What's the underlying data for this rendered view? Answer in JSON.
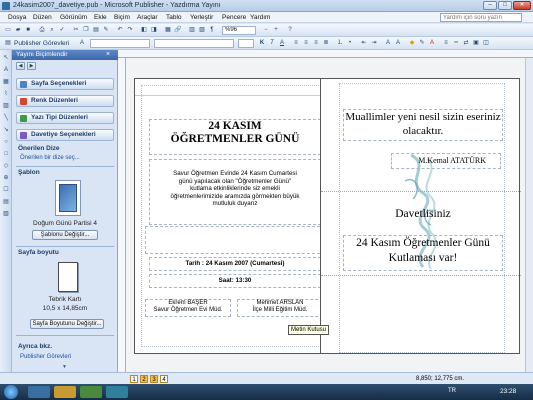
{
  "window": {
    "title": "24kasim2007_davetiye.pub - Microsoft Publisher - Yazdırma Yayını"
  },
  "menu": {
    "items": [
      "Dosya",
      "Düzen",
      "Görünüm",
      "Ekle",
      "Biçim",
      "Araçlar",
      "Tablo",
      "Yerleştir",
      "Pencere",
      "Yardım"
    ],
    "help_placeholder": "Yardım için soru yazın"
  },
  "toolbar": {
    "zoom": "%96",
    "tasks_label": "Publisher Görevleri"
  },
  "taskpane": {
    "title": "Yayını Biçimlendir",
    "sections": [
      "Sayfa Seçenekleri",
      "Renk Düzenleri",
      "Yazı Tipi Düzenleri",
      "Davetiye Seçenekleri"
    ],
    "design_label": "Önerilen Dize",
    "design_link": "Önerilen bir dize seç...",
    "template_label": "Şablon",
    "template_name": "Doğum Günü Partisi 4",
    "template_button": "Şablonu Değiştir...",
    "page_size_label": "Sayfa boyutu",
    "page_size_name": "Tebrik Kartı",
    "page_size_dims": "10,5 x 14,85cm",
    "page_size_button": "Sayfa Boyutunu Değiştir...",
    "see_also": "Ayrıca bkz.",
    "see_also_link": "Publisher Görevleri"
  },
  "left_page": {
    "title_line1": "24 KASIM",
    "title_line2": "ÖĞRETMENLER GÜNÜ",
    "body": "Savur Öğretmen Evinde 24 Kasım Cumartesi günü yapılacak olan \"Öğretmenler Günü\" kutlama etkinliklerinde siz emekli öğretmenlerimizide aramızda görmekten büyük mutluluk duyarız",
    "date": "Tarih : 24 Kasım 2007 (Cumartesi)",
    "time": "Saat: 13:30",
    "sig1_name": "Ekrem BAŞER",
    "sig1_title": "Savur Öğretmen Evi Müd.",
    "sig2_name": "Mehmet ARSLAN",
    "sig2_title": "İlçe Milli Eğitim Müd."
  },
  "right_page": {
    "quote": "Muallimler yeni nesil sizin eseriniz olacaktır.",
    "author": "M.Kemal ATATÜRK",
    "invite": "Davetlisiniz",
    "event": "24 Kasım Öğretmenler Günü Kutlaması var!"
  },
  "tooltip": "Metin Kutusu",
  "status": {
    "pages": [
      "1",
      "2",
      "3",
      "4"
    ],
    "coords": "8,850; 12,775 cm."
  },
  "taskbar": {
    "lang": "TR",
    "time": "23:28"
  }
}
